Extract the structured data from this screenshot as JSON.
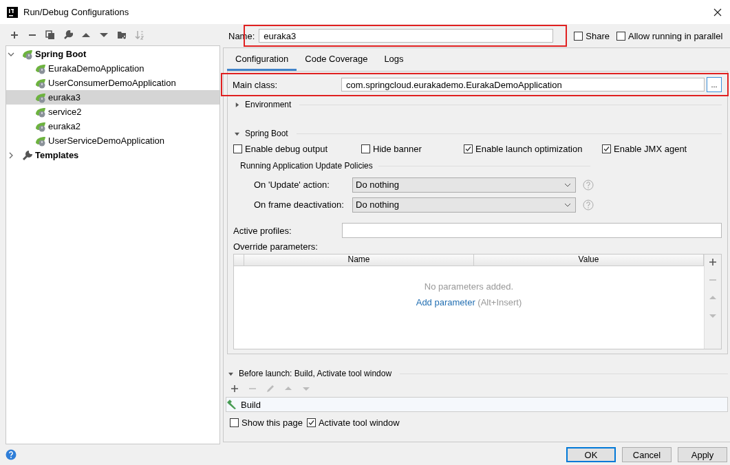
{
  "window": {
    "title": "Run/Debug Configurations"
  },
  "tree": [
    {
      "label": "Spring Boot",
      "kind": "spring",
      "expanded": true,
      "selected": false,
      "children": [
        {
          "label": "EurakaDemoApplication",
          "selected": false
        },
        {
          "label": "UserConsumerDemoApplication",
          "selected": false
        },
        {
          "label": "euraka3",
          "selected": true
        },
        {
          "label": "service2",
          "selected": false
        },
        {
          "label": "euraka2",
          "selected": false
        },
        {
          "label": "UserServiceDemoApplication",
          "selected": false
        }
      ]
    },
    {
      "label": "Templates",
      "kind": "wrench",
      "expanded": false,
      "selected": false
    }
  ],
  "name_field": {
    "label": "Name:",
    "value": "euraka3",
    "highlighted": true
  },
  "options": [
    {
      "label": "Share",
      "checked": false
    },
    {
      "label": "Allow running in parallel",
      "checked": false
    }
  ],
  "tabs": [
    {
      "label": "Configuration",
      "selected": true
    },
    {
      "label": "Code Coverage",
      "selected": false
    },
    {
      "label": "Logs",
      "selected": false
    }
  ],
  "main_class": {
    "label": "Main class:",
    "value": "com.springcloud.eurakademo.EurakaDemoApplication",
    "button": "...",
    "highlighted": true
  },
  "environment": {
    "label": "Environment",
    "expanded": false
  },
  "spring_boot": {
    "label": "Spring Boot",
    "expanded": true,
    "options": [
      {
        "label": "Enable debug output",
        "checked": false
      },
      {
        "label": "Hide banner",
        "checked": false
      },
      {
        "label": "Enable launch optimization",
        "checked": true
      },
      {
        "label": "Enable JMX agent",
        "checked": true
      }
    ]
  },
  "update_policies": {
    "title": "Running Application Update Policies",
    "rows": [
      {
        "label": "On 'Update' action:",
        "value": "Do nothing"
      },
      {
        "label": "On frame deactivation:",
        "value": "Do nothing"
      }
    ]
  },
  "active_profiles": {
    "label": "Active profiles:"
  },
  "override_parameters": {
    "label": "Override parameters:",
    "columns": [
      "Name",
      "Value"
    ],
    "empty_text": "No parameters added.",
    "add_link": "Add parameter",
    "shortcut": "(Alt+Insert)"
  },
  "before_launch": {
    "title": "Before launch: Build, Activate tool window",
    "expanded": true,
    "tasks": [
      {
        "label": "Build"
      }
    ]
  },
  "page_options": [
    {
      "label": "Show this page",
      "checked": false
    },
    {
      "label": "Activate tool window",
      "checked": true
    }
  ],
  "buttons": [
    {
      "label": "OK",
      "kind": "default"
    },
    {
      "label": "Cancel",
      "kind": "normal"
    },
    {
      "label": "Apply",
      "kind": "normal"
    }
  ]
}
